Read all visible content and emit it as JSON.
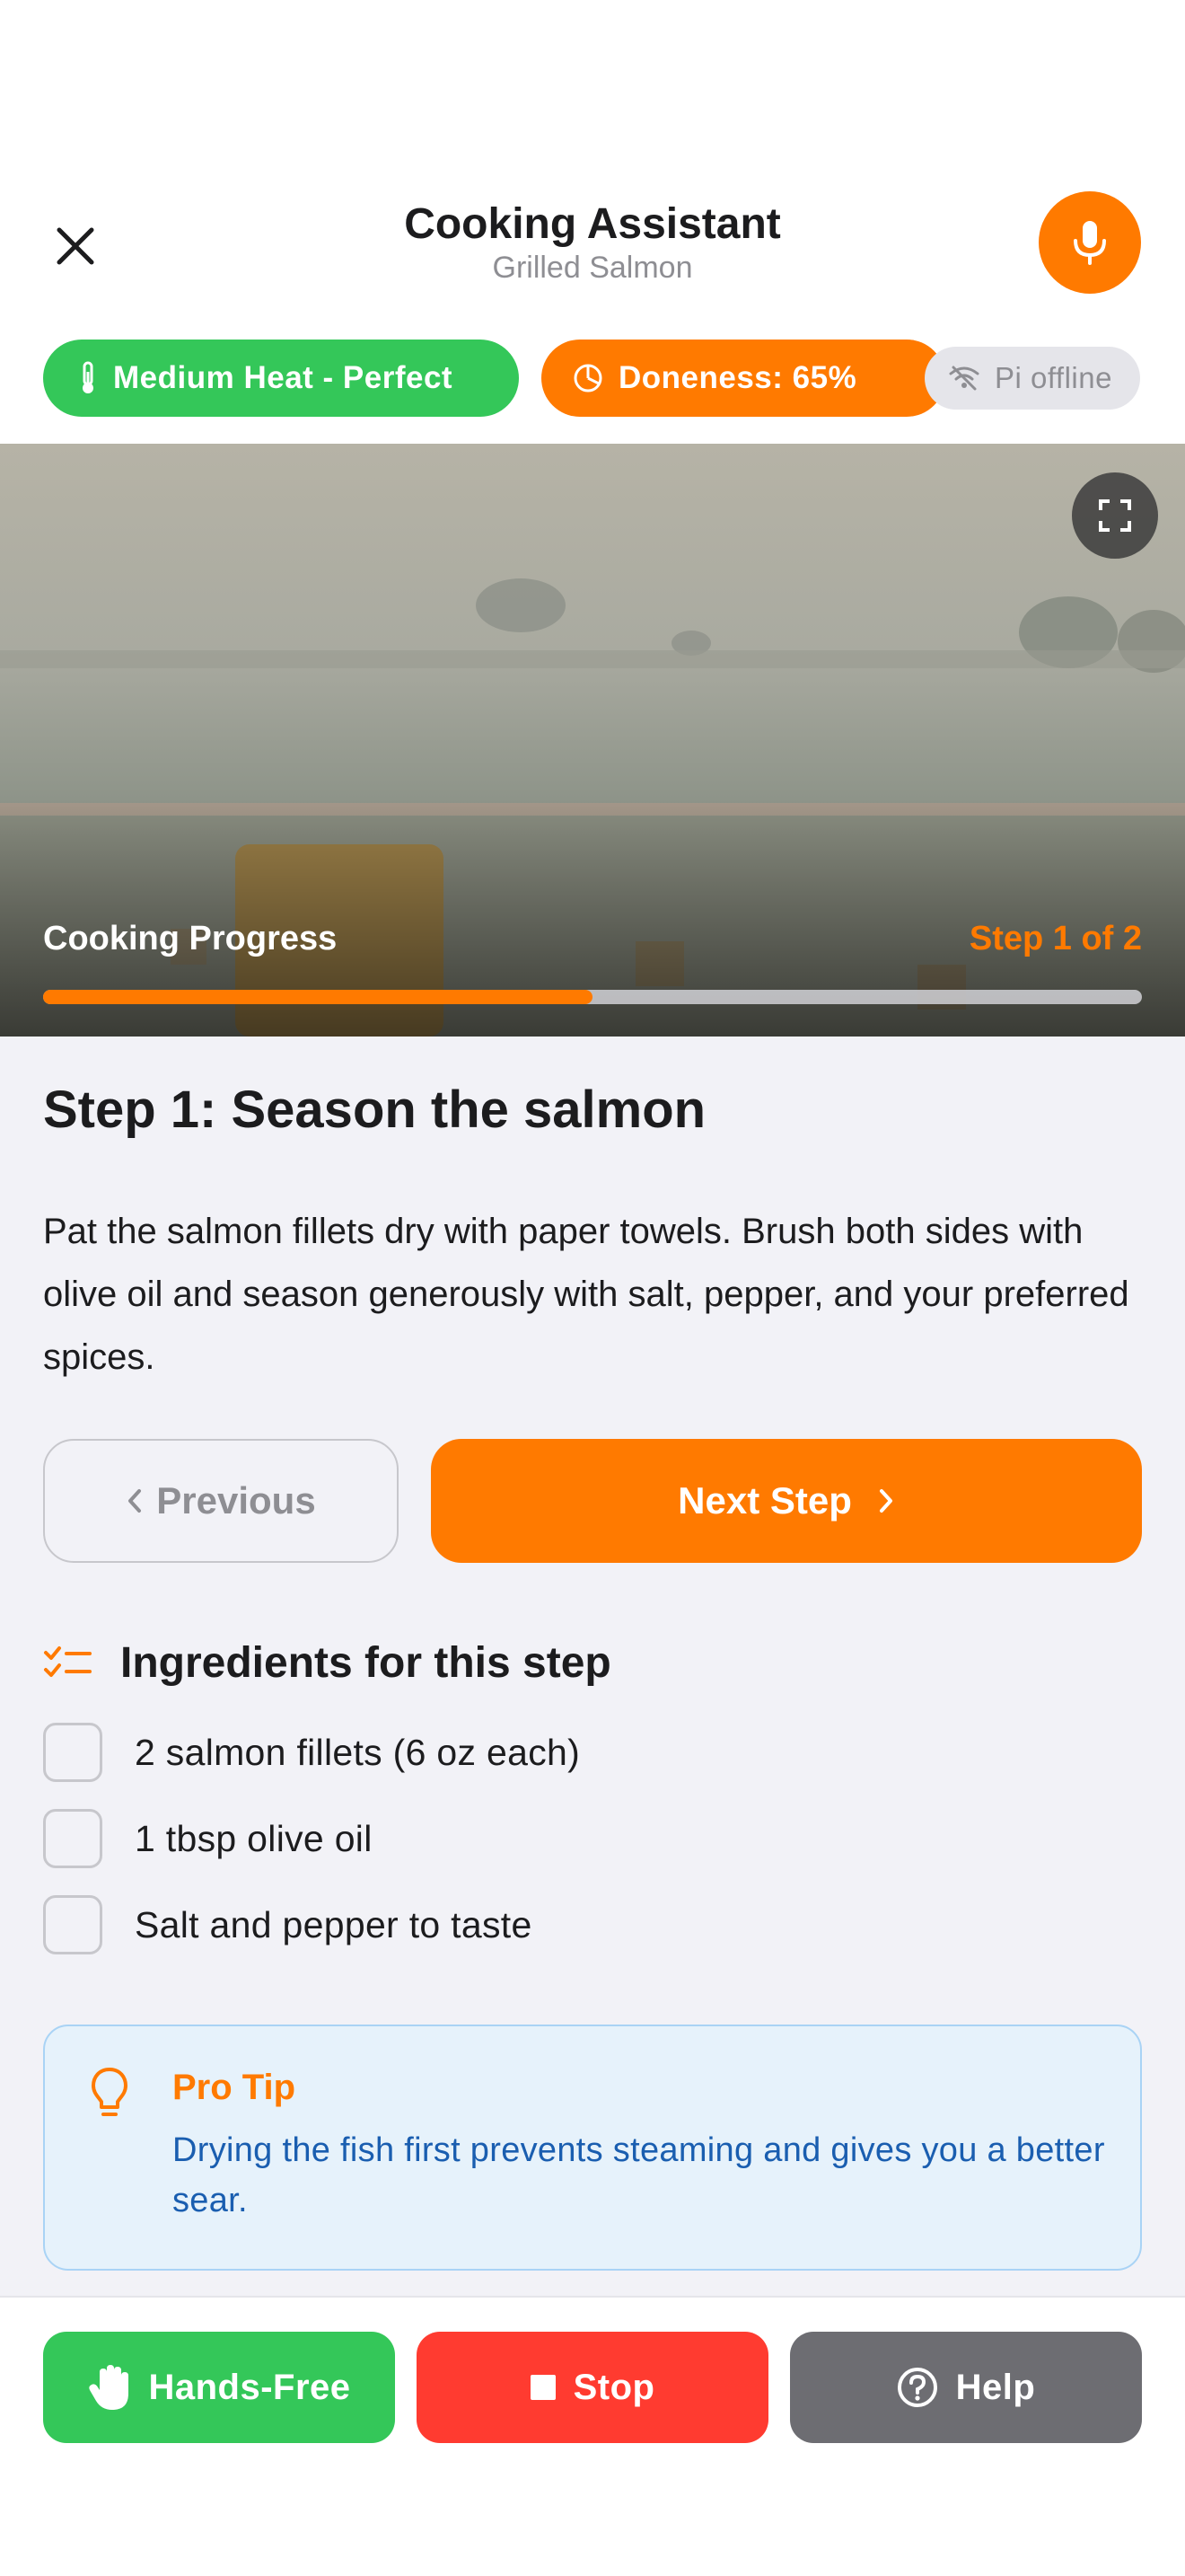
{
  "header": {
    "title": "Cooking Assistant",
    "subtitle": "Grilled Salmon"
  },
  "badges": {
    "heat": "Medium Heat - Perfect",
    "doneness": "Doneness: 65%",
    "pi_status": "Pi offline"
  },
  "hero": {
    "progress_label": "Cooking Progress",
    "step_counter": "Step 1 of 2",
    "progress_fraction": 0.5
  },
  "step": {
    "title": "Step 1: Season the salmon",
    "description": "Pat the salmon fillets dry with paper towels. Brush both sides with olive oil and season generously with salt, pepper, and your preferred spices."
  },
  "nav": {
    "previous_label": "Previous",
    "next_label": "Next Step"
  },
  "ingredients": {
    "title": "Ingredients for this step",
    "items": [
      "2 salmon fillets (6 oz each)",
      "1 tbsp olive oil",
      "Salt and pepper to taste"
    ]
  },
  "tip": {
    "title": "Pro Tip",
    "body": "Drying the fish first prevents steaming and gives you a better sear."
  },
  "bottom_bar": {
    "hands_free": "Hands-Free",
    "stop": "Stop",
    "help": "Help"
  },
  "colors": {
    "accent": "#ff7a00",
    "green": "#34c759",
    "red": "#ff3b30",
    "gray": "#6d6d72",
    "tip_text": "#1a5eb0"
  }
}
